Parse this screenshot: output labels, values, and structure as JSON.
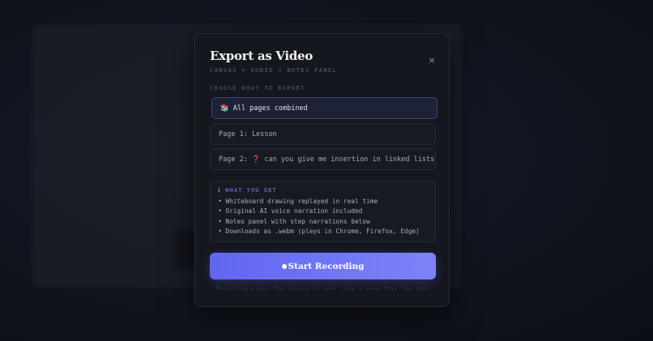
{
  "modal": {
    "title": "Export as Video",
    "subtitle": "CANVAS + AUDIO + NOTES PANEL",
    "close_icon": "×",
    "section_label": "CHOOSE WHAT TO EXPORT",
    "options": [
      {
        "emoji": "📚",
        "label": "All pages combined",
        "selected": true
      },
      {
        "emoji": "",
        "label": "Page 1: Lesson",
        "selected": false
      },
      {
        "emoji": "❓",
        "label": "can you give me insertion in linked lists",
        "prefix": "Page 2:",
        "selected": false
      }
    ],
    "info": {
      "title": "ℹ WHAT YOU GET",
      "items": [
        "• Whiteboard drawing replayed in real time",
        "• Original AI voice narration included",
        "• Notes panel with step narrations below",
        "• Downloads as .webm (plays in Chrome, Firefox, Edge)"
      ]
    },
    "start_button": "Start Recording",
    "footnote": "Recording plays the lesson in real time — keep this tab open"
  },
  "colors": {
    "accent": "#6366f1",
    "accent_end": "#7c84f8",
    "modal_bg": "#14171e",
    "selected_border": "#3d4575"
  },
  "icons": {
    "close": "close-icon",
    "record_dot": "record-dot-icon"
  }
}
